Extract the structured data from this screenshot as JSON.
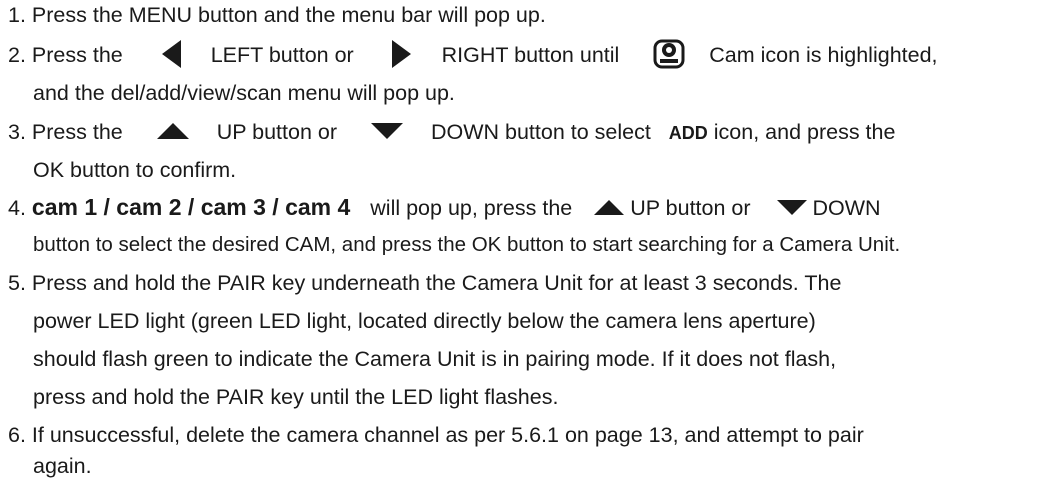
{
  "steps": [
    {
      "number": "1.",
      "text": "Press the MENU button and the menu bar will pop up."
    },
    {
      "number": "2.",
      "text_a": "Press the",
      "left_icon": "left-arrow-icon",
      "text_b": "LEFT button or",
      "right_icon": "right-arrow-icon",
      "text_c": "RIGHT button until",
      "cam_icon": "camera-icon",
      "text_d": "Cam icon is highlighted,",
      "text_e": "and the del/add/view/scan menu will pop up."
    },
    {
      "number": "3.",
      "text_a": "Press the",
      "up_icon": "up-arrow-icon",
      "text_b": "UP button or",
      "down_icon": "down-arrow-icon",
      "text_c": "DOWN button to select",
      "keyword": "ADD",
      "text_d": "icon, and press the",
      "text_e": "OK button to confirm."
    },
    {
      "number": "4.",
      "cams": "cam 1 / cam 2 / cam 3 / cam 4",
      "text_a": "will pop up, press the",
      "up_icon": "up-arrow-icon",
      "text_b": "UP button or",
      "down_icon": "down-arrow-icon",
      "text_c": "DOWN",
      "text_d": "button to select the desired CAM, and press the OK button to start searching for a Camera Unit."
    },
    {
      "number": "5.",
      "lines": [
        "Press and hold the PAIR key underneath the Camera Unit for at least 3 seconds. The",
        "power LED light (green LED light, located directly below the camera lens aperture)",
        "should flash green to indicate the Camera Unit is in pairing mode. If it does not flash,",
        "press and hold the PAIR key until the LED light flashes."
      ]
    },
    {
      "number": "6.",
      "lines": [
        "If unsuccessful, delete the camera channel as per 5.6.1 on page 13, and attempt to pair",
        "again."
      ]
    }
  ],
  "colors": {
    "text": "#1a1a1a",
    "icon": "#1a1a1a"
  }
}
